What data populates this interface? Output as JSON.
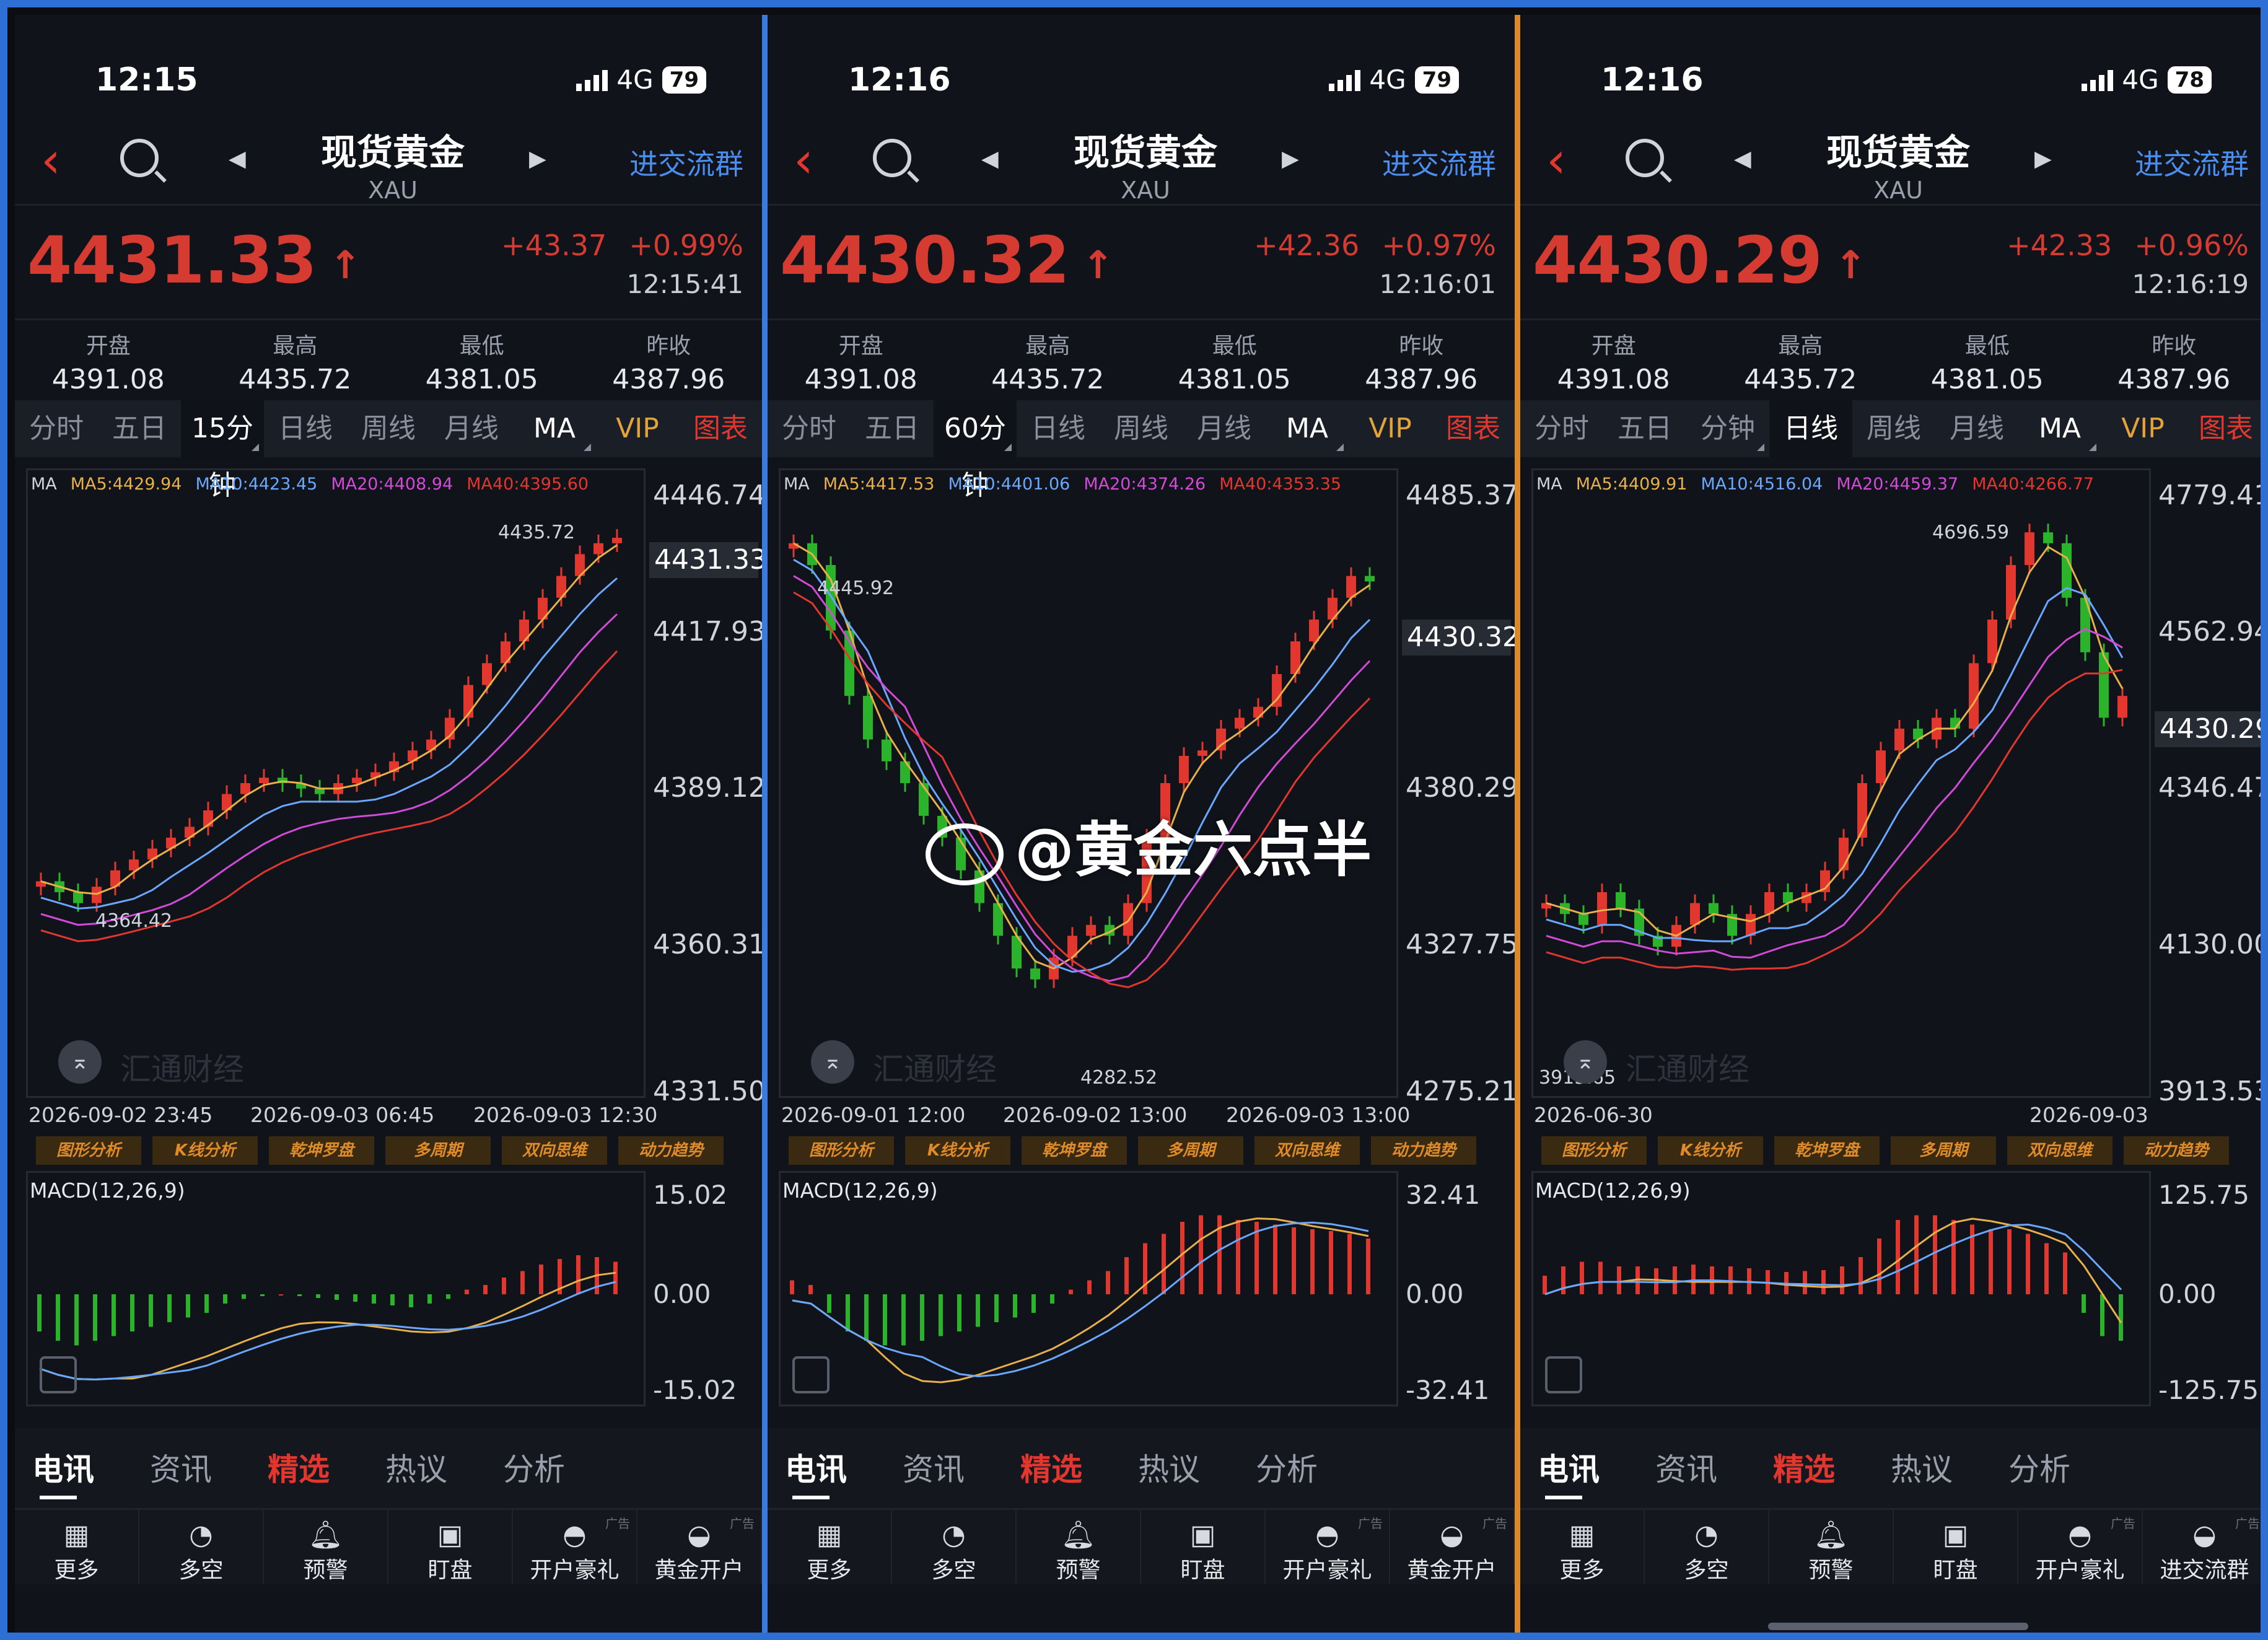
{
  "panels": [
    {
      "status": {
        "time": "12:15",
        "network": "4G",
        "battery": "79"
      },
      "header": {
        "title": "现货黄金",
        "symbol": "XAU",
        "join": "进交流群"
      },
      "quote": {
        "price": "4431.33",
        "change": "+43.37",
        "change_pct": "+0.99%",
        "time": "12:15:41"
      },
      "stats": [
        {
          "label": "开盘",
          "value": "4391.08"
        },
        {
          "label": "最高",
          "value": "4435.72"
        },
        {
          "label": "最低",
          "value": "4381.05"
        },
        {
          "label": "昨收",
          "value": "4387.96"
        }
      ],
      "tabs": [
        "分时",
        "五日",
        "15分钟",
        "日线",
        "周线",
        "月线",
        "MA",
        "VIP",
        "图表"
      ],
      "active_tab": 2,
      "ma_legend": {
        "ma": "MA",
        "ma5": "MA5:4429.94",
        "ma10": "MA10:4423.45",
        "ma20": "MA20:4408.94",
        "ma40": "MA40:4395.60"
      },
      "y_labels": [
        "4446.74",
        "4431.33",
        "4417.93",
        "4389.12",
        "4360.31",
        "4331.50"
      ],
      "high_label": "4435.72",
      "low_label": "4364.42",
      "time_labels": [
        "2026-09-02 23:45",
        "2026-09-03 06:45",
        "2026-09-03 12:30"
      ],
      "macd": {
        "title": "MACD(12,26,9)",
        "labels": [
          "15.02",
          "0.00",
          "-15.02"
        ]
      }
    },
    {
      "status": {
        "time": "12:16",
        "network": "4G",
        "battery": "79"
      },
      "header": {
        "title": "现货黄金",
        "symbol": "XAU",
        "join": "进交流群"
      },
      "quote": {
        "price": "4430.32",
        "change": "+42.36",
        "change_pct": "+0.97%",
        "time": "12:16:01"
      },
      "stats": [
        {
          "label": "开盘",
          "value": "4391.08"
        },
        {
          "label": "最高",
          "value": "4435.72"
        },
        {
          "label": "最低",
          "value": "4381.05"
        },
        {
          "label": "昨收",
          "value": "4387.96"
        }
      ],
      "tabs": [
        "分时",
        "五日",
        "60分钟",
        "日线",
        "周线",
        "月线",
        "MA",
        "VIP",
        "图表"
      ],
      "active_tab": 2,
      "ma_legend": {
        "ma": "MA",
        "ma5": "MA5:4417.53",
        "ma10": "MA10:4401.06",
        "ma20": "MA20:4374.26",
        "ma40": "MA40:4353.35"
      },
      "y_labels": [
        "4485.37",
        "4430.32",
        "4380.29",
        "4327.75",
        "4275.21"
      ],
      "high_label": "4445.92",
      "low_label": "4282.52",
      "time_labels": [
        "2026-09-01 12:00",
        "2026-09-02 13:00",
        "2026-09-03 13:00"
      ],
      "macd": {
        "title": "MACD(12,26,9)",
        "labels": [
          "32.41",
          "0.00",
          "-32.41"
        ]
      }
    },
    {
      "status": {
        "time": "12:16",
        "network": "4G",
        "battery": "78"
      },
      "header": {
        "title": "现货黄金",
        "symbol": "XAU",
        "join": "进交流群"
      },
      "quote": {
        "price": "4430.29",
        "change": "+42.33",
        "change_pct": "+0.96%",
        "time": "12:16:19"
      },
      "stats": [
        {
          "label": "开盘",
          "value": "4391.08"
        },
        {
          "label": "最高",
          "value": "4435.72"
        },
        {
          "label": "最低",
          "value": "4381.05"
        },
        {
          "label": "昨收",
          "value": "4387.96"
        }
      ],
      "tabs": [
        "分时",
        "五日",
        "分钟",
        "日线",
        "周线",
        "月线",
        "MA",
        "VIP",
        "图表"
      ],
      "active_tab": 3,
      "ma_legend": {
        "ma": "MA",
        "ma5": "MA5:4409.91",
        "ma10": "MA10:4516.04",
        "ma20": "MA20:4459.37",
        "ma40": "MA40:4266.77"
      },
      "y_labels": [
        "4779.41",
        "4562.94",
        "4430.29",
        "4346.47",
        "4130.00",
        "3913.53"
      ],
      "high_label": "4696.59",
      "low_label": "3913.65",
      "time_labels": [
        "2026-06-30",
        "2026-09-03"
      ],
      "macd": {
        "title": "MACD(12,26,9)",
        "labels": [
          "125.75",
          "0.00",
          "-125.75"
        ]
      }
    }
  ],
  "tools": [
    "图形分析",
    "K线分析",
    "乾坤罗盘",
    "多周期",
    "双向思维",
    "动力趋势"
  ],
  "news_tabs": [
    "电讯",
    "资讯",
    "精选",
    "热议",
    "分析"
  ],
  "bottom_items": [
    {
      "label": "更多",
      "icon": "grid-icon"
    },
    {
      "label": "多空",
      "icon": "trend-icon"
    },
    {
      "label": "预警",
      "icon": "bell-icon"
    },
    {
      "label": "盯盘",
      "icon": "chart-window-icon"
    },
    {
      "label": "开户豪礼",
      "icon": "gift-icon"
    },
    {
      "label": "黄金开户",
      "icon": "gold-icon"
    }
  ],
  "bottom_last_label_panel3": "进交流群",
  "ad_tag": "广告",
  "watermark": "汇通财经",
  "weibo_handle": "@黄金六点半",
  "colors": {
    "up": "#e2372f",
    "down": "#2bb32b",
    "accent": "#4a8ef0",
    "vip": "#e1a33a"
  }
}
